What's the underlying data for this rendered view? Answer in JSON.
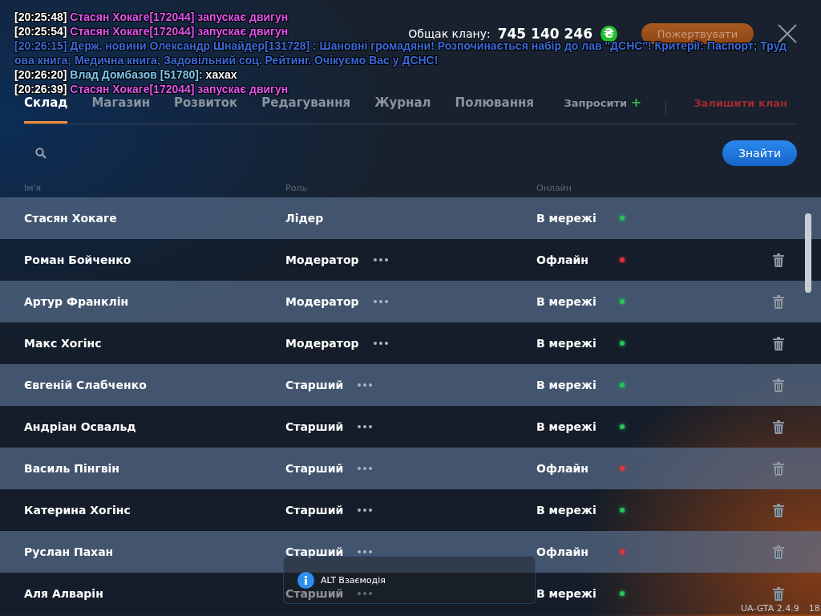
{
  "chat": [
    {
      "kind": "action",
      "time": "[20:25:48]",
      "text": "Стасян Хокаге[172044] запускає двигун"
    },
    {
      "kind": "action",
      "time": "[20:25:54]",
      "text": "Стасян Хокаге[172044] запускає двигун"
    },
    {
      "kind": "news",
      "time": "[20:26:15]",
      "text": "Держ. новини Олександр Шнайдер[131728] : Шановні громадяни! Розпочинається набір до лав ''ДСНС''! Критерії: Паспорт; Труд"
    },
    {
      "kind": "news",
      "text": "ова книга; Медична книга; Задовільний соц. Рейтинг. Очікуємо Вас у ДСНС!"
    },
    {
      "kind": "say",
      "time": "[20:26:20]",
      "author": "Влад Домбазов [51780]:",
      "text": "хахах"
    },
    {
      "kind": "action",
      "time": "[20:26:39]",
      "text": "Стасян Хокаге[172044] запускає двигун"
    }
  ],
  "treasury": {
    "label": "Общак клану:",
    "amount": "745 140 246",
    "currency": "₴",
    "donate_button": "Пожертвувати"
  },
  "tabs": [
    {
      "label": "Склад",
      "selected": true
    },
    {
      "label": "Магазин",
      "selected": false
    },
    {
      "label": "Розвиток",
      "selected": false
    },
    {
      "label": "Редагування",
      "selected": false
    },
    {
      "label": "Журнал",
      "selected": false
    },
    {
      "label": "Полювання",
      "selected": false
    }
  ],
  "invite_button": {
    "label": "Запросити",
    "icon": "+"
  },
  "leave_button": "Залишити клан",
  "search": {
    "button": "Знайти"
  },
  "columns": [
    "Ім'я",
    "Роль",
    "Онлайн"
  ],
  "members": [
    {
      "name": "Стасян Хокаге",
      "role": "Лідер",
      "actions": false,
      "status": "В мережі",
      "online": true,
      "deletable": false
    },
    {
      "name": "Роман Бойченко",
      "role": "Модератор",
      "actions": true,
      "status": "Офлайн",
      "online": false,
      "deletable": true
    },
    {
      "name": "Артур Франклін",
      "role": "Модератор",
      "actions": true,
      "status": "В мережі",
      "online": true,
      "deletable": true
    },
    {
      "name": "Макс Хогінс",
      "role": "Модератор",
      "actions": true,
      "status": "В мережі",
      "online": true,
      "deletable": true
    },
    {
      "name": "Євгеній Слабченко",
      "role": "Старший",
      "actions": true,
      "status": "В мережі",
      "online": true,
      "deletable": true
    },
    {
      "name": "Андріан Освальд",
      "role": "Старший",
      "actions": true,
      "status": "В мережі",
      "online": true,
      "deletable": true
    },
    {
      "name": "Василь Пінгвін",
      "role": "Старший",
      "actions": true,
      "status": "Офлайн",
      "online": false,
      "deletable": true
    },
    {
      "name": "Катерина Хогінс",
      "role": "Старший",
      "actions": true,
      "status": "В мережі",
      "online": true,
      "deletable": true
    },
    {
      "name": "Руслан Пахан",
      "role": "Старший",
      "actions": true,
      "status": "Офлайн",
      "online": false,
      "deletable": true
    },
    {
      "name": "Аля Алварін",
      "role": "Старший",
      "actions": true,
      "status": "В мережі",
      "online": true,
      "deletable": true
    }
  ],
  "hint": {
    "key": "ALT",
    "text": "Взаємодія"
  },
  "version": "UA-GTA 2.4.9",
  "corner_text": "18"
}
